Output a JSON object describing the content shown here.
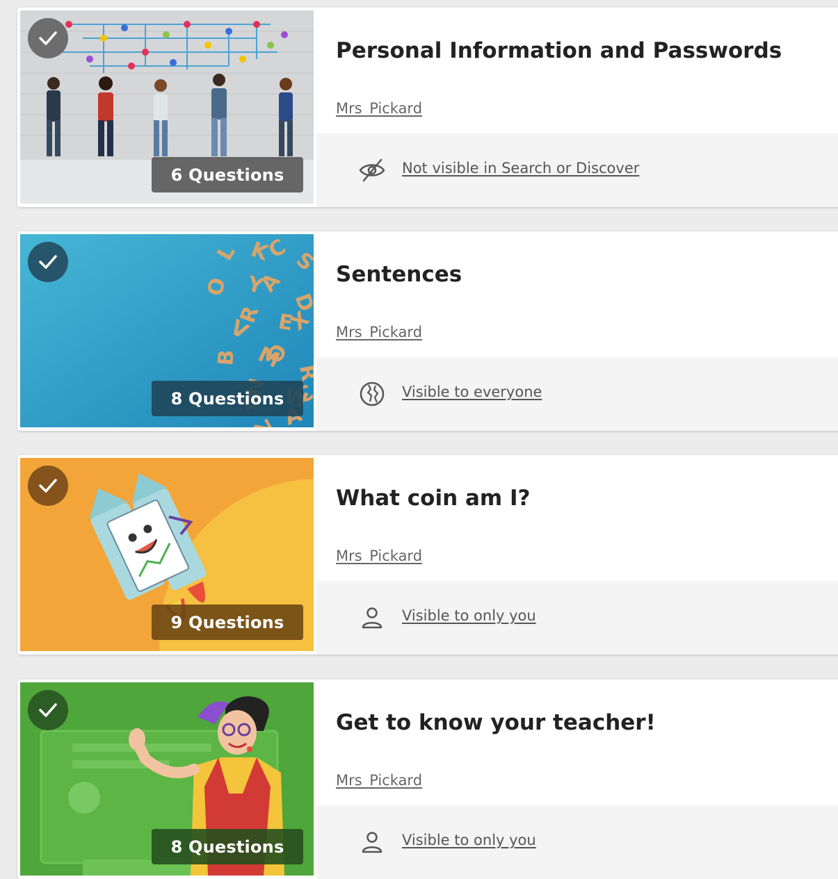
{
  "quizzes": [
    {
      "title": "Personal Information and Passwords",
      "author": "Mrs_Pickard",
      "questions": "6 Questions",
      "visibility": "Not visible in Search or Discover",
      "visibility_icon": "eye-slash-icon",
      "thumb_bg": "#d9dbdc"
    },
    {
      "title": "Sentences",
      "author": "Mrs_Pickard",
      "questions": "8 Questions",
      "visibility": "Visible to everyone",
      "visibility_icon": "globe-icon",
      "thumb_bg": "#2e9cc7"
    },
    {
      "title": "What coin am I?",
      "author": "Mrs_Pickard",
      "questions": "9 Questions",
      "visibility": "Visible to only you",
      "visibility_icon": "person-icon",
      "thumb_bg": "#f3a53a"
    },
    {
      "title": "Get to know your teacher!",
      "author": "Mrs_Pickard",
      "questions": "8 Questions",
      "visibility": "Visible to only you",
      "visibility_icon": "person-icon",
      "thumb_bg": "#4fa63a"
    }
  ]
}
